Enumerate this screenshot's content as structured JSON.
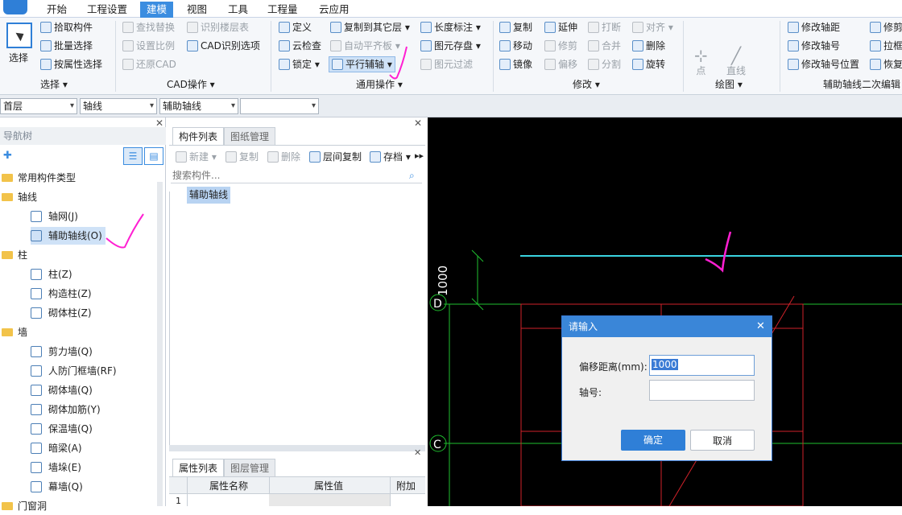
{
  "menu": [
    "开始",
    "工程设置",
    "建模",
    "视图",
    "工具",
    "工程量",
    "云应用"
  ],
  "ribbon": {
    "select": "选择",
    "pick": "拾取构件",
    "batch": "批量选择",
    "by_attr": "按属性选择",
    "group_select": "选择",
    "find_replace": "查找替换",
    "set_ratio": "设置比例",
    "restore_cad": "还原CAD",
    "identify_layers": "识别楼层表",
    "cad_options": "CAD识别选项",
    "group_cad": "CAD操作",
    "define": "定义",
    "cloud_check": "云检查",
    "lock": "锁定",
    "copy_to_layer": "复制到其它层",
    "auto_align": "自动平齐板",
    "parallel_aux": "平行辅轴",
    "length_mark": "长度标注",
    "element_save": "图元存盘",
    "element_filter": "图元过滤",
    "group_general": "通用操作",
    "copy": "复制",
    "move": "移动",
    "mirror": "镜像",
    "extend": "延伸",
    "trim": "修剪",
    "offset": "偏移",
    "break": "打断",
    "merge": "合并",
    "split": "分割",
    "align": "对齐",
    "delete": "删除",
    "rotate": "旋转",
    "group_modify": "修改",
    "point": "点",
    "line": "直线",
    "group_draw": "绘图",
    "modify_axis_dist": "修改轴距",
    "modify_axis_no": "修改轴号",
    "modify_axis_pos": "修改轴号位置",
    "trim2": "修剪",
    "stretch": "拉框",
    "restore": "恢复",
    "group_aux_edit": "辅助轴线二次编辑"
  },
  "dropdowns": [
    "首层",
    "轴线",
    "辅助轴线",
    ""
  ],
  "nav": {
    "title": "导航树",
    "items": [
      {
        "label": "常用构件类型",
        "level": 0
      },
      {
        "label": "轴线",
        "level": 0
      },
      {
        "label": "轴网(J)",
        "level": 1
      },
      {
        "label": "辅助轴线(O)",
        "level": 1
      },
      {
        "label": "柱",
        "level": 0
      },
      {
        "label": "柱(Z)",
        "level": 1
      },
      {
        "label": "构造柱(Z)",
        "level": 1
      },
      {
        "label": "砌体柱(Z)",
        "level": 1
      },
      {
        "label": "墙",
        "level": 0
      },
      {
        "label": "剪力墙(Q)",
        "level": 1
      },
      {
        "label": "人防门框墙(RF)",
        "level": 1
      },
      {
        "label": "砌体墙(Q)",
        "level": 1
      },
      {
        "label": "砌体加筋(Y)",
        "level": 1
      },
      {
        "label": "保温墙(Q)",
        "level": 1
      },
      {
        "label": "暗梁(A)",
        "level": 1
      },
      {
        "label": "墙垛(E)",
        "level": 1
      },
      {
        "label": "幕墙(Q)",
        "level": 1
      },
      {
        "label": "门窗洞",
        "level": 0
      }
    ]
  },
  "components": {
    "tab1": "构件列表",
    "tab2": "图纸管理",
    "new": "新建",
    "copy": "复制",
    "delete": "删除",
    "floor_copy": "层间复制",
    "save": "存档",
    "search_placeholder": "搜索构件...",
    "item": "辅助轴线"
  },
  "props": {
    "tab1": "属性列表",
    "tab2": "图层管理",
    "col_name": "属性名称",
    "col_value": "属性值",
    "col_extra": "附加",
    "row_no": "1"
  },
  "canvas": {
    "dim_label": "1000",
    "axis_d": "D",
    "axis_c": "C"
  },
  "dialog": {
    "title": "请输入",
    "offset_label": "偏移距离(mm):",
    "offset_value": "1000",
    "axis_label": "轴号:",
    "axis_value": "",
    "ok": "确定",
    "cancel": "取消"
  },
  "colors": {
    "accent": "#3b8de0",
    "canvas_bg": "#000000",
    "axis_green": "#1fbf2f",
    "grid_red": "#d0222a",
    "aux_cyan": "#3ad4e0",
    "annotation": "#ff1fd2"
  }
}
